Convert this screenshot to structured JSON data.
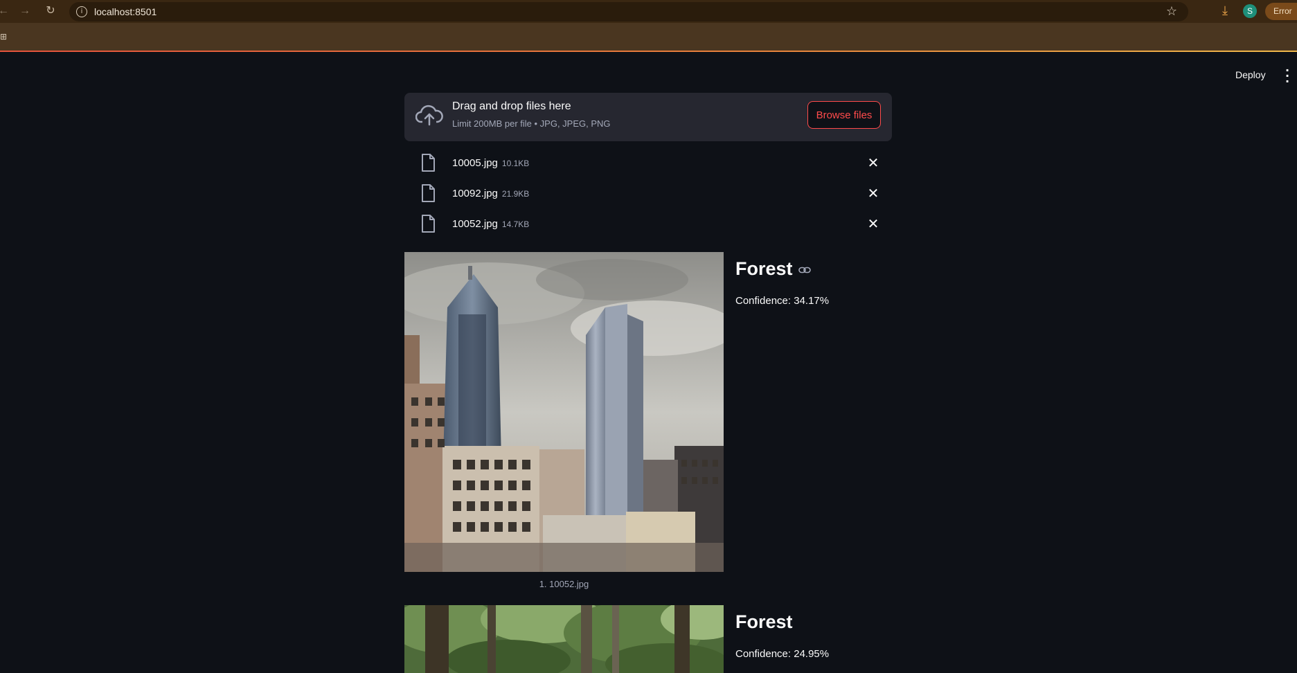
{
  "browser": {
    "url": "localhost:8501",
    "profile_initial": "S",
    "error_label": "Error"
  },
  "header": {
    "deploy_label": "Deploy"
  },
  "uploader": {
    "title": "Drag and drop files here",
    "subtitle": "Limit 200MB per file • JPG, JPEG, PNG",
    "browse_label": "Browse files",
    "files": [
      {
        "name": "10005.jpg",
        "size": "10.1KB"
      },
      {
        "name": "10092.jpg",
        "size": "21.9KB"
      },
      {
        "name": "10052.jpg",
        "size": "14.7KB"
      }
    ]
  },
  "results": [
    {
      "caption": "1. 10052.jpg",
      "label": "Forest",
      "confidence": "Confidence: 34.17%"
    },
    {
      "caption": "",
      "label": "Forest",
      "confidence": "Confidence: 24.95%"
    }
  ],
  "colors": {
    "accent": "#ff4b4b",
    "background": "#0e1117",
    "panel": "#262730"
  }
}
